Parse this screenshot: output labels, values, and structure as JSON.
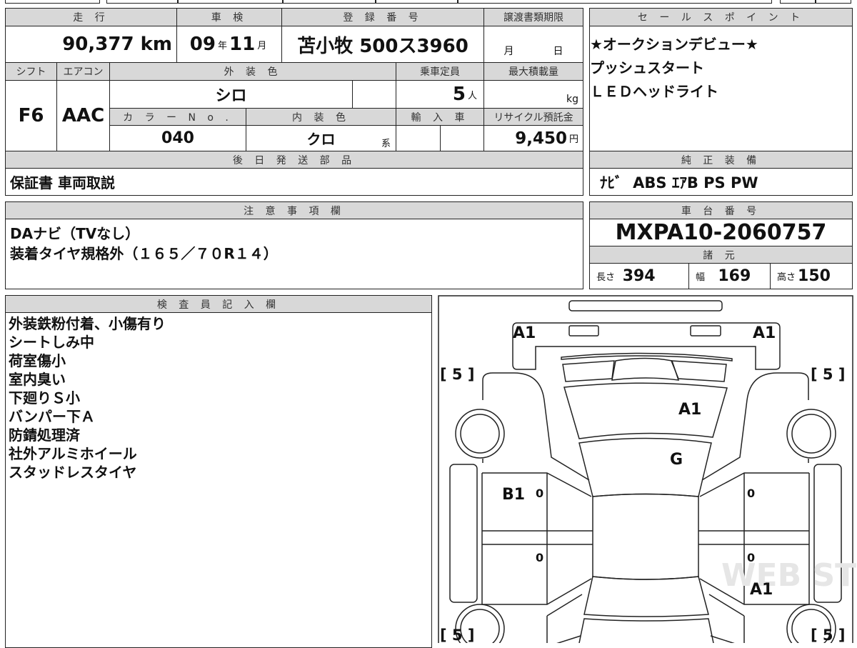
{
  "mileage": {
    "label": "走 行",
    "value": "90,377",
    "unit": "km"
  },
  "inspection": {
    "label": "車 検",
    "year": "09",
    "year_unit": "年",
    "month": "11",
    "month_unit": "月"
  },
  "registration": {
    "label": "登 録 番 号",
    "value": "苫小牧 500ス3960"
  },
  "transfer_deadline": {
    "label": "譲渡書類期限",
    "month_unit": "月",
    "day_unit": "日"
  },
  "shift": {
    "label": "シフト",
    "value": "F6"
  },
  "aircon": {
    "label": "エアコン",
    "value": "AAC"
  },
  "exterior_color": {
    "label": "外 装 色",
    "value": "シロ"
  },
  "capacity": {
    "label": "乗車定員",
    "value": "5",
    "unit": "人"
  },
  "max_load": {
    "label": "最大積載量",
    "unit": "kg"
  },
  "color_no": {
    "label": "カ ラ ー N o .",
    "value": "040"
  },
  "interior_color": {
    "label": "内 装 色",
    "value": "クロ",
    "suffix": "系"
  },
  "import": {
    "label": "輸 入 車"
  },
  "recycle": {
    "label": "リサイクル預託金",
    "value": "9,450",
    "unit": "円"
  },
  "later_parts": {
    "label": "後 日 発 送 部 品",
    "value": "保証書 車両取説"
  },
  "sales_points": {
    "label": "セ ー ル ス ポ イ ン ト",
    "items": [
      "★オークションデビュー★",
      "プッシュスタート",
      "ＬＥＤヘッドライト"
    ]
  },
  "equipment": {
    "label": "純 正 装 備",
    "value": "ﾅﾋﾞ  ABS ｴｱB PS PW"
  },
  "notes": {
    "label": "注 意 事 項 欄",
    "items": [
      "DAナビ（TVなし）",
      "装着タイヤ規格外（１６５／７０R１４）"
    ]
  },
  "chassis": {
    "label": "車 台 番 号",
    "value": "MXPA10-2060757"
  },
  "specs": {
    "label": "諸 元",
    "length_label": "長さ",
    "length": "394",
    "width_label": "幅",
    "width": "169",
    "height_label": "高さ",
    "height": "150"
  },
  "inspector": {
    "label": "検 査 員 記 入 欄",
    "items": [
      "外装鉄粉付着、小傷有り",
      "シートしみ中",
      "荷室傷小",
      "室内臭い",
      "下廻りＳ小",
      "バンパー下Ａ",
      "防錆処理済",
      "社外アルミホイール",
      "スタッドレスタイヤ"
    ]
  },
  "diagram": {
    "marks": {
      "front_left": "A1",
      "front_right": "A1",
      "hood": "A1",
      "windshield": "G",
      "left_front_door": "B1",
      "right_rear": "A1",
      "door_zero": "0"
    },
    "tire_bracket": "[ 5 ]",
    "watermark": "WEB STUDIO RU"
  }
}
